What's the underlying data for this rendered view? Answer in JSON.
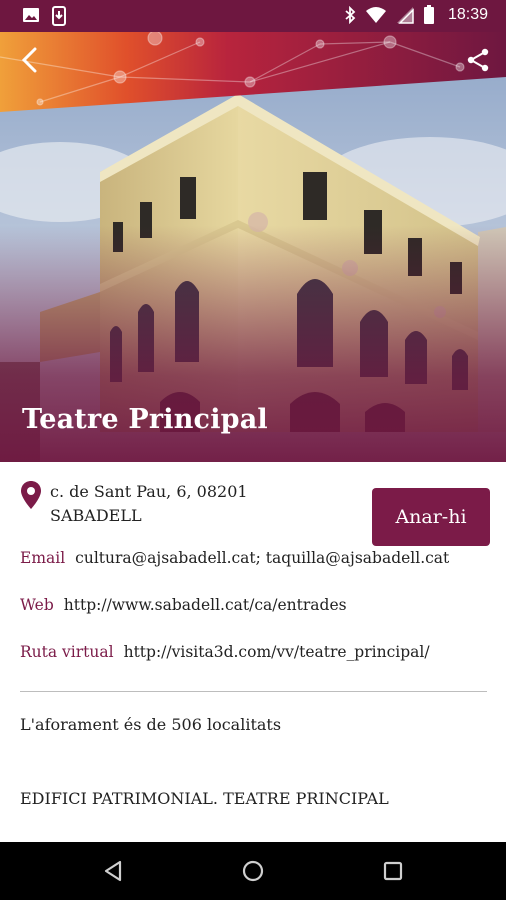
{
  "status_bar": {
    "time": "18:39",
    "icons": [
      "image-icon",
      "phone-download-icon",
      "bluetooth-icon",
      "wifi-icon",
      "signal-icon",
      "battery-icon"
    ]
  },
  "header": {
    "back_icon": "back-arrow-icon",
    "share_icon": "share-icon"
  },
  "hero": {
    "title": "Teatre Principal"
  },
  "address": {
    "line1": "c. de Sant Pau, 6, 08201",
    "line2": "SABADELL",
    "go_button_label": "Anar-hi"
  },
  "info": {
    "email_label": "Email",
    "email_value": "cultura@ajsabadell.cat; taquilla@ajsabadell.cat",
    "web_label": "Web",
    "web_value": "http://www.sabadell.cat/ca/entrades",
    "virtual_label": "Ruta virtual",
    "virtual_value": "http://visita3d.com/vv/teatre_principal/"
  },
  "description": {
    "capacity": "L'aforament és de 506 localitats",
    "heritage": "EDIFICI PATRIMONIAL. TEATRE PRINCIPAL"
  },
  "colors": {
    "brand": "#7b1b48",
    "status_bar": "#6e1740"
  }
}
